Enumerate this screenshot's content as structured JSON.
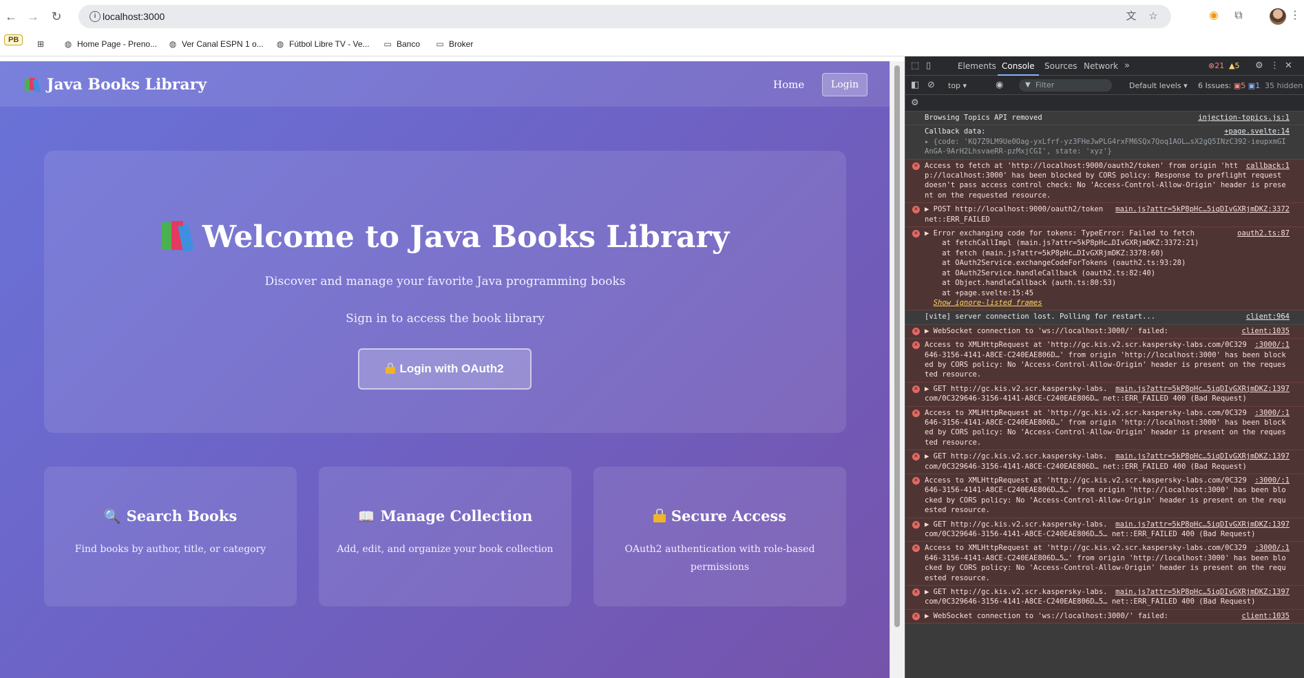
{
  "browser": {
    "url": "localhost:3000",
    "bookmarks": [
      {
        "icon": "globe-icon",
        "label": "Home Page - Preno..."
      },
      {
        "icon": "globe-icon",
        "label": "Ver Canal ESPN 1 o..."
      },
      {
        "icon": "globe-icon",
        "label": "Fútbol Libre TV - Ve..."
      },
      {
        "icon": "folder-icon",
        "label": "Banco"
      },
      {
        "icon": "folder-icon",
        "label": "Broker"
      }
    ],
    "profile_badge": "PB"
  },
  "app": {
    "brand": "Java Books Library",
    "nav": {
      "home": "Home",
      "login": "Login"
    },
    "hero": {
      "title": "Welcome to Java Books Library",
      "subtitle": "Discover and manage your favorite Java programming books",
      "signin_text": "Sign in to access the book library",
      "oauth_button": "Login with OAuth2"
    },
    "features": [
      {
        "icon": "magnifier-icon",
        "title": "Search Books",
        "desc": "Find books by author, title, or category"
      },
      {
        "icon": "open-book-icon",
        "title": "Manage Collection",
        "desc": "Add, edit, and organize your book collection"
      },
      {
        "icon": "lock-icon",
        "title": "Secure Access",
        "desc": "OAuth2 authentication with role-based permissions"
      }
    ],
    "colors": {
      "gradient_start": "#6a73d8",
      "gradient_end": "#7553ab"
    }
  },
  "devtools": {
    "tabs": [
      "Elements",
      "Console",
      "Sources",
      "Network"
    ],
    "active_tab": "Console",
    "error_count": "21",
    "warning_count": "5",
    "context": "top",
    "filter_placeholder": "Filter",
    "levels": "Default levels",
    "issues_label": "6 Issues:",
    "issues_errors": "5",
    "issues_info": "1",
    "hidden": "35 hidden",
    "messages": [
      {
        "type": "info",
        "text": "Browsing Topics API removed",
        "src": "injection-topics.js:1"
      },
      {
        "type": "info",
        "text": "Callback data:",
        "src": "+page.svelte:14"
      },
      {
        "type": "error",
        "text": "Access to fetch at 'http://localhost:9000/oauth2/token' from origin 'http://localhost:3000' has been blocked by CORS policy: Response to preflight request doesn't pass access control check: No 'Access-Control-Allow-Origin' header is present on the requested resource.",
        "src": "callback:1"
      },
      {
        "type": "error",
        "text": "▶ POST http://localhost:9000/oauth2/token net::ERR_FAILED",
        "src": "main.js?attr=5kP8pHc…5iqDIvGXRjmDKZ:3372"
      },
      {
        "type": "error",
        "text": "▶ Error exchanging code for tokens: TypeError: Failed to fetch\n    at fetchCallImpl (main.js?attr=5kP8pHc…DIvGXRjmDKZ:3372:21)\n    at fetch (main.js?attr=5kP8pHc…DIvGXRjmDKZ:3378:60)\n    at OAuth2Service.exchangeCodeForTokens (oauth2.ts:93:28)\n    at OAuth2Service.handleCallback (oauth2.ts:82:40)\n    at Object.handleCallback (auth.ts:80:53)\n    at +page.svelte:15:45",
        "src": "oauth2.ts:87"
      },
      {
        "type": "info",
        "text": "[vite] server connection lost. Polling for restart...",
        "src": "client:964"
      },
      {
        "type": "error",
        "text": "▶ WebSocket connection to 'ws://localhost:3000/' failed:",
        "src": "client:1035"
      },
      {
        "type": "error",
        "text": "Access to XMLHttpRequest at 'http://gc.kis.v2.scr.kaspersky-labs.com/0C329646-3156-4141-A8CE-C240EAE806D…' from origin 'http://localhost:3000' has been blocked by CORS policy: No 'Access-Control-Allow-Origin' header is present on the requested resource.",
        "src": ":3000/:1"
      },
      {
        "type": "error",
        "text": "▶ GET http://gc.kis.v2.scr.kaspersky-labs.com/0C329646-3156-4141-A8CE-C240EAE806D… net::ERR_FAILED 400 (Bad Request)",
        "src": "main.js?attr=5kP8pHc…5iqDIvGXRjmDKZ:1397"
      },
      {
        "type": "error",
        "text": "Access to XMLHttpRequest at 'http://gc.kis.v2.scr.kaspersky-labs.com/0C329646-3156-4141-A8CE-C240EAE806D…' from origin 'http://localhost:3000' has been blocked by CORS policy: No 'Access-Control-Allow-Origin' header is present on the requested resource.",
        "src": ":3000/:1"
      },
      {
        "type": "error",
        "text": "▶ GET http://gc.kis.v2.scr.kaspersky-labs.com/0C329646-3156-4141-A8CE-C240EAE806D… net::ERR_FAILED 400 (Bad Request)",
        "src": "main.js?attr=5kP8pHc…5iqDIvGXRjmDKZ:1397"
      },
      {
        "type": "error",
        "text": "Access to XMLHttpRequest at 'http://gc.kis.v2.scr.kaspersky-labs.com/0C329646-3156-4141-A8CE-C240EAE806D…5…' from origin 'http://localhost:3000' has been blocked by CORS policy: No 'Access-Control-Allow-Origin' header is present on the requested resource.",
        "src": ":3000/:1"
      },
      {
        "type": "error",
        "text": "▶ GET http://gc.kis.v2.scr.kaspersky-labs.com/0C329646-3156-4141-A8CE-C240EAE806D…5… net::ERR_FAILED 400 (Bad Request)",
        "src": "main.js?attr=5kP8pHc…5iqDIvGXRjmDKZ:1397"
      },
      {
        "type": "error",
        "text": "Access to XMLHttpRequest at 'http://gc.kis.v2.scr.kaspersky-labs.com/0C329646-3156-4141-A8CE-C240EAE806D…5…' from origin 'http://localhost:3000' has been blocked by CORS policy: No 'Access-Control-Allow-Origin' header is present on the requested resource.",
        "src": ":3000/:1"
      },
      {
        "type": "error",
        "text": "▶ GET http://gc.kis.v2.scr.kaspersky-labs.com/0C329646-3156-4141-A8CE-C240EAE806D…5… net::ERR_FAILED 400 (Bad Request)",
        "src": "main.js?attr=5kP8pHc…5iqDIvGXRjmDKZ:1397"
      },
      {
        "type": "error",
        "text": "▶ WebSocket connection to 'ws://localhost:3000/' failed:",
        "src": "client:1035"
      }
    ],
    "callback_object": "{code: 'KQ7Z9LM9Ue0Oag-yxLfrf-yz3FHeJwPLG4rxFM6SQx7Qoq1AOL…sX2gQ5INzC392-ieupxmGIAnGA-9ArH2LhsvaeRR-pzMxjCGI', state: 'xyz'}",
    "show_ignore": "Show ignore-listed frames"
  }
}
